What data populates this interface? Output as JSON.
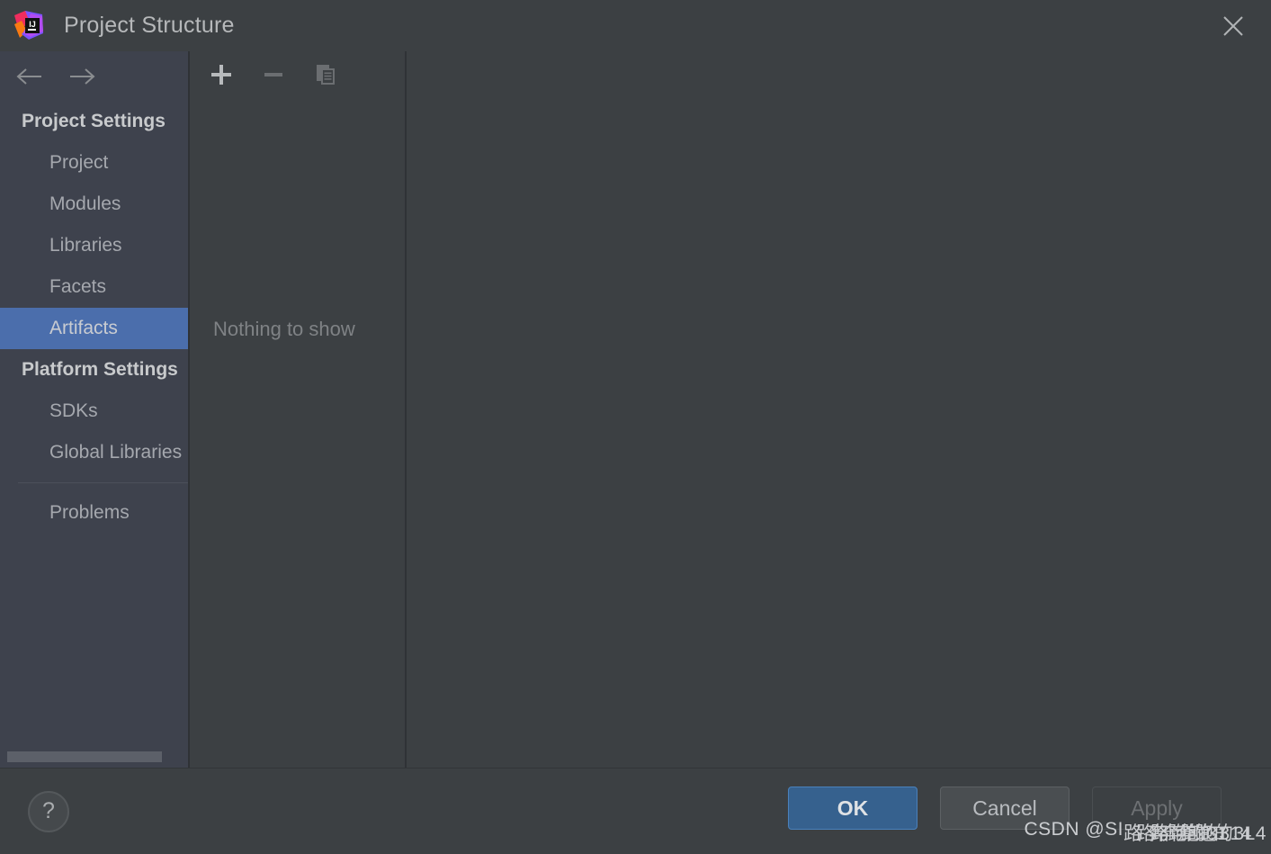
{
  "window": {
    "title": "Project Structure",
    "logo_icon": "intellij-idea-logo",
    "close_icon": "close-icon"
  },
  "navigation": {
    "back_icon": "arrow-left-icon",
    "forward_icon": "arrow-right-icon"
  },
  "sidebar": {
    "groups": [
      {
        "label": "Project Settings",
        "items": [
          {
            "label": "Project",
            "selected": false
          },
          {
            "label": "Modules",
            "selected": false
          },
          {
            "label": "Libraries",
            "selected": false
          },
          {
            "label": "Facets",
            "selected": false
          },
          {
            "label": "Artifacts",
            "selected": true
          }
        ]
      },
      {
        "label": "Platform Settings",
        "items": [
          {
            "label": "SDKs",
            "selected": false
          },
          {
            "label": "Global Libraries",
            "selected": false
          }
        ]
      }
    ],
    "footer_item": {
      "label": "Problems"
    },
    "scrollbar": "horizontal-scrollbar"
  },
  "artifacts_panel": {
    "toolbar": [
      {
        "name": "add-artifact-button",
        "icon": "plus-icon",
        "enabled": true
      },
      {
        "name": "remove-artifact-button",
        "icon": "minus-icon",
        "enabled": false
      },
      {
        "name": "copy-artifact-button",
        "icon": "copy-icon",
        "enabled": false
      }
    ],
    "empty_message": "Nothing to show"
  },
  "footer": {
    "help_label": "?",
    "buttons": [
      {
        "label": "OK",
        "style": "primary"
      },
      {
        "label": "Cancel",
        "style": "normal"
      },
      {
        "label": "Apply",
        "style": "disabled"
      }
    ]
  },
  "watermark": {
    "prefix": "CSDN @SI",
    "layer1": "路 奔跑的31",
    "layer2": "路 奔跑的314",
    "layer3": "路 奔跑的3L4"
  },
  "colors": {
    "dialog_background": "#3c4043",
    "sidebar_background": "#3e424d",
    "selection_blue": "#4b6eac",
    "primary_button": "#36618e",
    "text_primary": "#b6b8ba",
    "text_muted": "#7f8285"
  }
}
